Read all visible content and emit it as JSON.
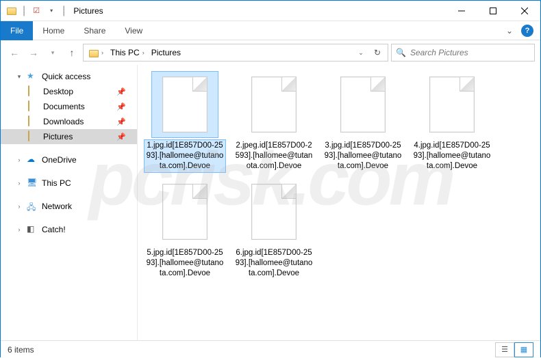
{
  "titlebar": {
    "title": "Pictures",
    "separator": "|"
  },
  "ribbon": {
    "tabs": [
      "File",
      "Home",
      "Share",
      "View"
    ]
  },
  "breadcrumb": {
    "segments": [
      "This PC",
      "Pictures"
    ]
  },
  "search": {
    "placeholder": "Search Pictures"
  },
  "sidebar": {
    "quick_access": "Quick access",
    "quick_items": [
      {
        "label": "Desktop",
        "pinned": true
      },
      {
        "label": "Documents",
        "pinned": true
      },
      {
        "label": "Downloads",
        "pinned": true
      },
      {
        "label": "Pictures",
        "pinned": true,
        "selected": true
      }
    ],
    "onedrive": "OneDrive",
    "thispc": "This PC",
    "network": "Network",
    "catch": "Catch!"
  },
  "files": [
    {
      "name": "1.jpg.id[1E857D00-2593].[hallomee@tutanota.com].Devoe",
      "selected": true
    },
    {
      "name": "2.jpeg.id[1E857D00-2593].[hallomee@tutanota.com].Devoe"
    },
    {
      "name": "3.jpg.id[1E857D00-2593].[hallomee@tutanota.com].Devoe"
    },
    {
      "name": "4.jpg.id[1E857D00-2593].[hallomee@tutanota.com].Devoe"
    },
    {
      "name": "5.jpg.id[1E857D00-2593].[hallomee@tutanota.com].Devoe"
    },
    {
      "name": "6.jpg.id[1E857D00-2593].[hallomee@tutanota.com].Devoe"
    }
  ],
  "status": {
    "text": "6 items"
  },
  "watermark": "pcrisk.com"
}
